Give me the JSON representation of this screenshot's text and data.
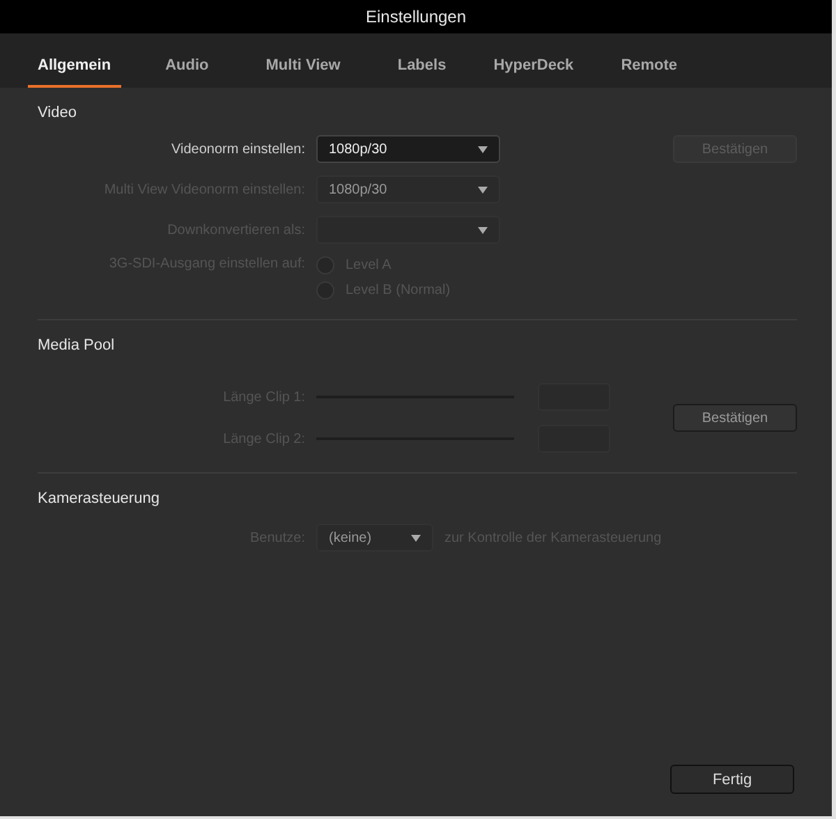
{
  "window": {
    "title": "Einstellungen"
  },
  "tabs": [
    {
      "label": "Allgemein",
      "selected": true
    },
    {
      "label": "Audio",
      "selected": false
    },
    {
      "label": "Multi View",
      "selected": false
    },
    {
      "label": "Labels",
      "selected": false
    },
    {
      "label": "HyperDeck",
      "selected": false
    },
    {
      "label": "Remote",
      "selected": false
    }
  ],
  "video": {
    "heading": "Video",
    "confirm_button": {
      "label": "Bestätigen",
      "disabled": true
    },
    "rows": [
      {
        "kind": "select",
        "label": "Videonorm einstellen:",
        "value": "1080p/30",
        "disabled": false
      },
      {
        "kind": "select",
        "label": "Multi View Videonorm einstellen:",
        "value": "1080p/30",
        "disabled": true
      },
      {
        "kind": "select",
        "label": "Downkonvertieren als:",
        "disabled": true
      },
      {
        "kind": "radio",
        "label": "3G-SDI-Ausgang einstellen auf:",
        "disabled": true,
        "options": [
          {
            "label": "Level A",
            "selected": false
          },
          {
            "label": "Level B (Normal)",
            "selected": false
          }
        ]
      }
    ]
  },
  "media_pool": {
    "heading": "Media Pool",
    "confirm_button": {
      "label": "Bestätigen",
      "disabled": false
    },
    "rows": [
      {
        "label": "Länge Clip 1:",
        "disabled": true
      },
      {
        "label": "Länge Clip 2:",
        "disabled": true
      }
    ]
  },
  "camera_control": {
    "heading": "Kamerasteuerung",
    "label": "Benutze:",
    "value": "(keine)",
    "suffix": "zur Kontrolle der Kamerasteuerung",
    "disabled": true
  },
  "done_button": {
    "label": "Fertig"
  }
}
